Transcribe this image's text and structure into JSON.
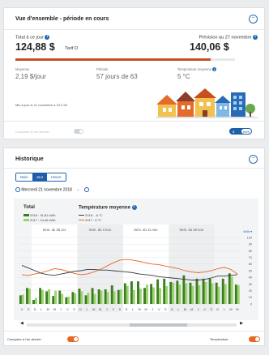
{
  "overview": {
    "title": "Vue d'ensemble - période en cours",
    "total_label": "Total à ce jour",
    "total_value": "124,88 $",
    "tarif": "Tarif D",
    "forecast_label": "Prévision au 27 novembre",
    "forecast_value": "140,06 $",
    "progress_fraction": 0.89,
    "avg_label": "Moyenne",
    "avg_value": "2,19 $/jour",
    "period_label": "Période",
    "period_value": "57 jours de 63",
    "temp_label": "Température moyenne",
    "temp_value": "5 °C",
    "updated": "Mis à jour le 21 novembre à 23 h 59",
    "compare_label": "Comparer à l'an dernier",
    "unit_left": "$",
    "unit_right": "kWh"
  },
  "history": {
    "title": "Historique",
    "tabs": [
      "Mois",
      "Jour",
      "Heure"
    ],
    "active_tab": 1,
    "date": "Mercredi 21 novembre 2018",
    "total_label": "Total",
    "legend_2018": "2018 : 31,81 kWh",
    "legend_2017": "2017 : 24,46 kWh",
    "temp_title": "Température moyenne",
    "temp_2018": "2018 : -6 °C",
    "temp_2017": "2017 : 6 °C",
    "weeks": [
      "Sem. du 28 oct.",
      "Sem. du 4 nov.",
      "Sem. du 11 nov.",
      "Sem. du 18 nov."
    ],
    "y_unit": "kWh ▾",
    "compare_label": "Comparer à l'an dernier",
    "temp_toggle_label": "Température"
  },
  "chart_data": {
    "type": "bar",
    "categories": [
      "V",
      "S",
      "D",
      "L",
      "M",
      "M",
      "J",
      "V",
      "S",
      "D",
      "L",
      "M",
      "M",
      "J",
      "V",
      "S",
      "D",
      "L",
      "M",
      "M",
      "J",
      "V",
      "S",
      "D",
      "L",
      "M",
      "M",
      "J",
      "V",
      "S",
      "D",
      "L",
      "M",
      "M"
    ],
    "y_ticks": [
      0,
      10,
      20,
      30,
      40,
      50,
      60,
      70,
      80,
      90,
      100
    ],
    "ylim": [
      0,
      100
    ],
    "series": [
      {
        "name": "2018",
        "values": [
          13,
          24,
          6,
          24,
          19,
          12,
          20,
          10,
          18,
          23,
          13,
          24,
          22,
          22,
          28,
          21,
          31,
          34,
          34,
          24,
          30,
          37,
          38,
          33,
          35,
          43,
          32,
          38,
          38,
          38,
          32,
          38,
          46,
          29
        ]
      },
      {
        "name": "2017",
        "values": [
          14,
          23,
          9,
          21,
          22,
          20,
          15,
          11,
          16,
          19,
          17,
          15,
          20,
          18,
          19,
          22,
          27,
          21,
          23,
          29,
          25,
          24,
          27,
          32,
          29,
          31,
          27,
          28,
          33,
          31,
          26,
          30,
          41,
          28
        ]
      },
      {
        "name": "Température 2018",
        "values": [
          58,
          54,
          50,
          46,
          44,
          43,
          45,
          47,
          49,
          50,
          52,
          52,
          51,
          51,
          50,
          49,
          48,
          47,
          45,
          44,
          43,
          41,
          40,
          39,
          38,
          37,
          36,
          36,
          37,
          39,
          42,
          42,
          43,
          44
        ]
      },
      {
        "name": "Température 2017",
        "values": [
          44,
          43,
          45,
          47,
          50,
          53,
          52,
          49,
          46,
          44,
          45,
          48,
          52,
          57,
          62,
          66,
          67,
          66,
          64,
          62,
          60,
          59,
          57,
          55,
          53,
          50,
          48,
          47,
          48,
          50,
          53,
          55,
          52,
          45
        ]
      }
    ]
  }
}
